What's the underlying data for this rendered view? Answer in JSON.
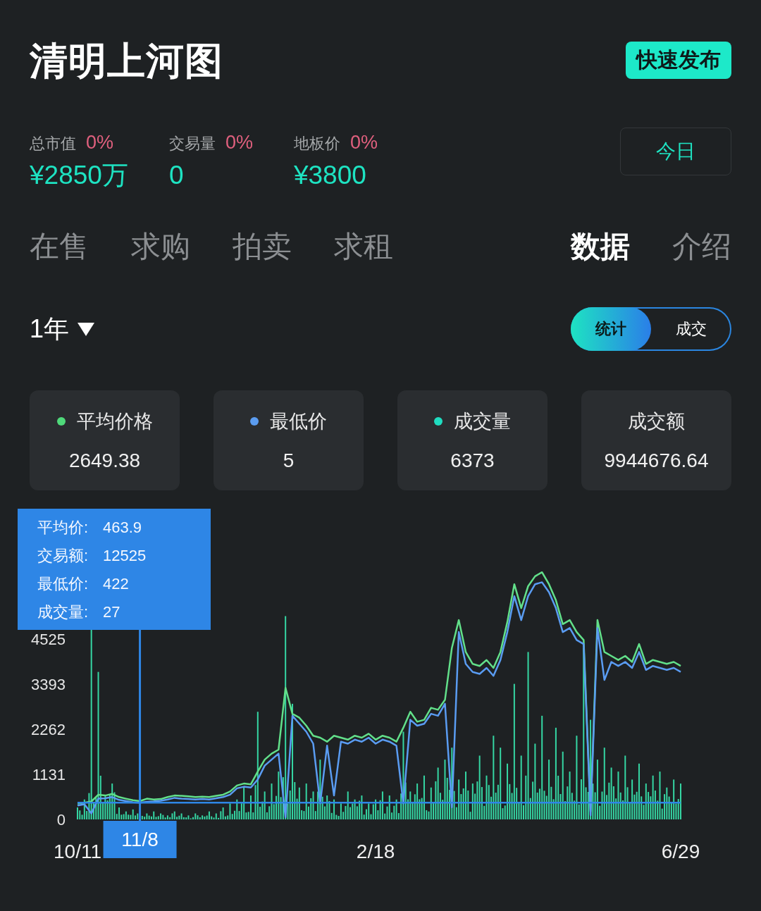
{
  "header": {
    "title": "清明上河图",
    "publish_button": "快速发布"
  },
  "stats": [
    {
      "label": "总市值",
      "change": "0%",
      "value": "¥2850万"
    },
    {
      "label": "交易量",
      "change": "0%",
      "value": "0"
    },
    {
      "label": "地板价",
      "change": "0%",
      "value": "¥3800"
    }
  ],
  "date_button": "今日",
  "tab_groups": [
    {
      "tabs": [
        {
          "label": "在售",
          "selected": false
        },
        {
          "label": "求购",
          "selected": false
        },
        {
          "label": "拍卖",
          "selected": false
        },
        {
          "label": "求租",
          "selected": false
        }
      ]
    },
    {
      "tabs": [
        {
          "label": "数据",
          "selected": true
        },
        {
          "label": "介绍",
          "selected": false
        }
      ]
    }
  ],
  "period_dropdown": {
    "label": "1年"
  },
  "view_toggle": [
    {
      "label": "统计",
      "selected": true
    },
    {
      "label": "成交",
      "selected": false
    }
  ],
  "stat_cards": [
    {
      "label": "平均价格",
      "value": "2649.38",
      "color": "#4fd97a"
    },
    {
      "label": "最低价",
      "value": "5",
      "color": "#5b9cf0"
    },
    {
      "label": "成交量",
      "value": "6373",
      "color": "#1fdcc0"
    },
    {
      "label": "成交额",
      "value": "9944676.64"
    }
  ],
  "chart": {
    "tooltip": [
      {
        "label": "平均价:",
        "value": "463.9"
      },
      {
        "label": "交易额:",
        "value": "12525"
      },
      {
        "label": "最低价:",
        "value": "422"
      },
      {
        "label": "成交量:",
        "value": "27"
      }
    ],
    "chart_data": {
      "type": "line",
      "ylim": [
        0,
        6787
      ],
      "yticks": [
        {
          "value": 0,
          "label": "0"
        },
        {
          "value": 1131,
          "label": "1131"
        },
        {
          "value": 2262,
          "label": "2262"
        },
        {
          "value": 3393,
          "label": "3393"
        },
        {
          "value": 4525,
          "label": "4525"
        }
      ],
      "categories": [
        "10/11",
        null,
        null,
        null,
        null,
        null,
        null,
        null,
        null,
        "11/8",
        null,
        null,
        null,
        null,
        null,
        null,
        null,
        null,
        null,
        null,
        null,
        null,
        null,
        null,
        null,
        null,
        null,
        null,
        null,
        null,
        null,
        null,
        null,
        null,
        null,
        null,
        null,
        null,
        null,
        null,
        null,
        null,
        null,
        "2/18",
        null,
        null,
        null,
        null,
        null,
        null,
        null,
        null,
        null,
        null,
        null,
        null,
        null,
        null,
        null,
        null,
        null,
        null,
        null,
        null,
        null,
        null,
        null,
        null,
        null,
        null,
        null,
        null,
        null,
        null,
        null,
        null,
        null,
        null,
        null,
        null,
        null,
        null,
        null,
        null,
        null,
        null,
        null,
        "6/29"
      ],
      "series": [
        {
          "color": "#62e08a",
          "values": [
            400,
            420,
            450,
            620,
            600,
            640,
            560,
            520,
            480,
            460,
            520,
            500,
            510,
            560,
            600,
            590,
            580,
            560,
            570,
            560,
            590,
            620,
            700,
            850,
            900,
            880,
            1200,
            1500,
            1650,
            1750,
            3300,
            2650,
            2550,
            2350,
            2100,
            2050,
            1950,
            2100,
            2050,
            2000,
            2100,
            2050,
            2150,
            2000,
            2100,
            2050,
            1950,
            2300,
            2700,
            2450,
            2500,
            2800,
            2750,
            3000,
            4300,
            5000,
            4200,
            3900,
            3850,
            4000,
            3800,
            4200,
            4950,
            5900,
            5300,
            5850,
            6100,
            6200,
            5900,
            5500,
            4900,
            5000,
            4700,
            4500,
            200,
            5000,
            4200,
            4100,
            4000,
            4100,
            3950,
            4400,
            3900,
            4000,
            3950,
            3900,
            3950,
            3850
          ]
        },
        {
          "color": "#5a9cf2",
          "values": [
            350,
            380,
            150,
            520,
            530,
            560,
            490,
            460,
            430,
            420,
            440,
            450,
            470,
            500,
            540,
            520,
            510,
            500,
            510,
            500,
            530,
            560,
            620,
            780,
            820,
            800,
            1000,
            1350,
            1500,
            1650,
            50,
            2600,
            2400,
            2200,
            1900,
            400,
            1850,
            600,
            1950,
            1900,
            2000,
            1950,
            2050,
            1900,
            2000,
            1950,
            1850,
            400,
            2500,
            2350,
            2400,
            2650,
            2600,
            2900,
            300,
            4700,
            3900,
            3700,
            3650,
            3800,
            3600,
            4000,
            4700,
            5600,
            5000,
            5600,
            5900,
            5950,
            5700,
            5300,
            4700,
            4800,
            4500,
            4400,
            100,
            4800,
            3500,
            3950,
            3850,
            3950,
            3800,
            4200,
            3750,
            3850,
            3800,
            3750,
            3800,
            3700
          ]
        }
      ],
      "annotations": [
        {
          "x": "11/8"
        }
      ]
    }
  }
}
